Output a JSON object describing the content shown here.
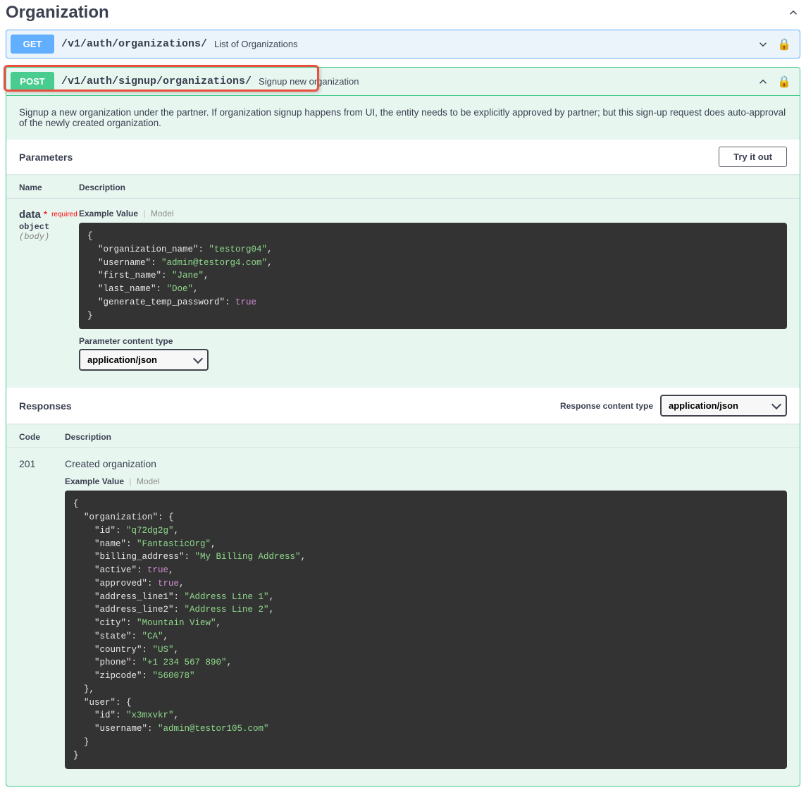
{
  "section": {
    "title": "Organization"
  },
  "ops": {
    "get": {
      "method": "GET",
      "path": "/v1/auth/organizations/",
      "summary": "List of Organizations"
    },
    "post": {
      "method": "POST",
      "path": "/v1/auth/signup/organizations/",
      "summary": "Signup new organization",
      "description": "Signup a new organization under the partner. If organization signup happens from UI, the entity needs to be explicitly approved by partner; but this sign-up request does auto-approval of the newly created organization."
    }
  },
  "labels": {
    "parameters": "Parameters",
    "try": "Try it out",
    "name": "Name",
    "description": "Description",
    "example_value": "Example Value",
    "model": "Model",
    "param_content_type": "Parameter content type",
    "responses": "Responses",
    "response_content_type": "Response content type",
    "code": "Code",
    "required": "required"
  },
  "param": {
    "name": "data",
    "star": "*",
    "type": "object",
    "in": "(body)"
  },
  "content_types": {
    "selected": "application/json"
  },
  "request_example": {
    "lines": [
      {
        "t": "{",
        "cls": ""
      },
      {
        "t": "  \"organization_name\": ",
        "cls": "k",
        "s": "\"testorg04\"",
        "post": ","
      },
      {
        "t": "  \"username\": ",
        "cls": "k",
        "s": "\"admin@testorg4.com\"",
        "post": ","
      },
      {
        "t": "  \"first_name\": ",
        "cls": "k",
        "s": "\"Jane\"",
        "post": ","
      },
      {
        "t": "  \"last_name\": ",
        "cls": "k",
        "s": "\"Doe\"",
        "post": ","
      },
      {
        "t": "  \"generate_temp_password\": ",
        "cls": "k",
        "b": "true",
        "post": ""
      },
      {
        "t": "}",
        "cls": ""
      }
    ]
  },
  "response": {
    "code": "201",
    "title": "Created organization",
    "lines": [
      {
        "t": "{",
        "cls": ""
      },
      {
        "t": "  \"organization\": {",
        "cls": ""
      },
      {
        "t": "    \"id\": ",
        "cls": "k",
        "s": "\"q72dg2g\"",
        "post": ","
      },
      {
        "t": "    \"name\": ",
        "cls": "k",
        "s": "\"FantasticOrg\"",
        "post": ","
      },
      {
        "t": "    \"billing_address\": ",
        "cls": "k",
        "s": "\"My Billing Address\"",
        "post": ","
      },
      {
        "t": "    \"active\": ",
        "cls": "k",
        "b": "true",
        "post": ","
      },
      {
        "t": "    \"approved\": ",
        "cls": "k",
        "b": "true",
        "post": ","
      },
      {
        "t": "    \"address_line1\": ",
        "cls": "k",
        "s": "\"Address Line 1\"",
        "post": ","
      },
      {
        "t": "    \"address_line2\": ",
        "cls": "k",
        "s": "\"Address Line 2\"",
        "post": ","
      },
      {
        "t": "    \"city\": ",
        "cls": "k",
        "s": "\"Mountain View\"",
        "post": ","
      },
      {
        "t": "    \"state\": ",
        "cls": "k",
        "s": "\"CA\"",
        "post": ","
      },
      {
        "t": "    \"country\": ",
        "cls": "k",
        "s": "\"US\"",
        "post": ","
      },
      {
        "t": "    \"phone\": ",
        "cls": "k",
        "s": "\"+1 234 567 890\"",
        "post": ","
      },
      {
        "t": "    \"zipcode\": ",
        "cls": "k",
        "s": "\"560078\"",
        "post": ""
      },
      {
        "t": "  },",
        "cls": ""
      },
      {
        "t": "  \"user\": {",
        "cls": ""
      },
      {
        "t": "    \"id\": ",
        "cls": "k",
        "s": "\"x3mxvkr\"",
        "post": ","
      },
      {
        "t": "    \"username\": ",
        "cls": "k",
        "s": "\"admin@testor105.com\"",
        "post": ""
      },
      {
        "t": "  }",
        "cls": ""
      },
      {
        "t": "}",
        "cls": ""
      }
    ]
  }
}
